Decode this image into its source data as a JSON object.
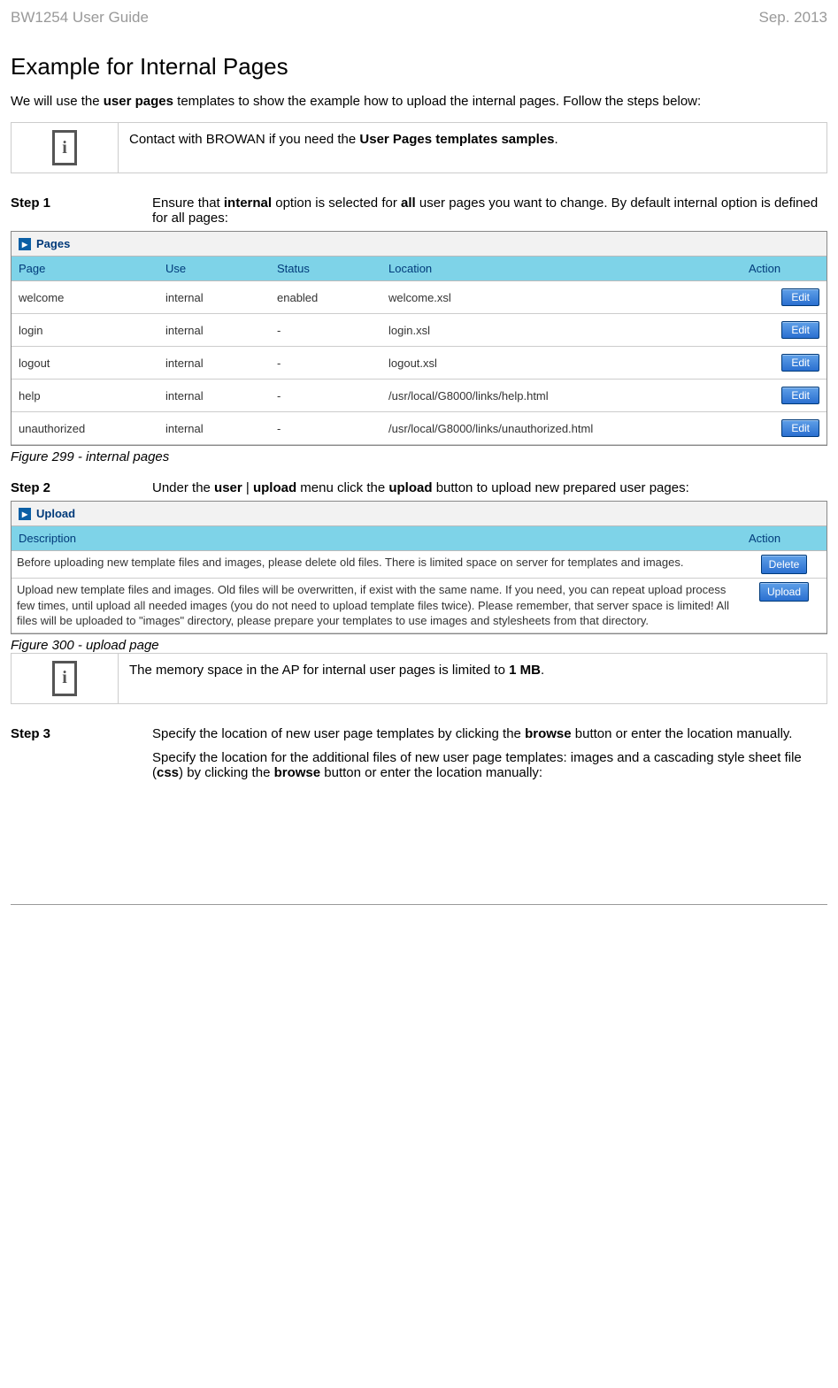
{
  "header": {
    "left": "BW1254 User Guide",
    "right": "Sep. 2013"
  },
  "title": "Example for Internal Pages",
  "intro": {
    "pre": "We will use the ",
    "bold1": "user pages",
    "post": " templates to show the example how to upload the internal pages. Follow the steps below:"
  },
  "note1": {
    "pre": "Contact with BROWAN if you need the ",
    "bold": "User Pages templates samples",
    "post": "."
  },
  "step1": {
    "label": "Step 1",
    "t1": "Ensure that ",
    "b1": "internal",
    "t2": " option is selected for ",
    "b2": "all",
    "t3": " user pages you want to change. By default internal option is defined for all pages:"
  },
  "pages_panel_title": "Pages",
  "pages_cols": {
    "page": "Page",
    "use": "Use",
    "status": "Status",
    "location": "Location",
    "action": "Action"
  },
  "pages_rows": [
    {
      "page": "welcome",
      "use": "internal",
      "status": "enabled",
      "location": "welcome.xsl"
    },
    {
      "page": "login",
      "use": "internal",
      "status": "-",
      "location": "login.xsl"
    },
    {
      "page": "logout",
      "use": "internal",
      "status": "-",
      "location": "logout.xsl"
    },
    {
      "page": "help",
      "use": "internal",
      "status": "-",
      "location": "/usr/local/G8000/links/help.html"
    },
    {
      "page": "unauthorized",
      "use": "internal",
      "status": "-",
      "location": "/usr/local/G8000/links/unauthorized.html"
    }
  ],
  "edit_label": "Edit",
  "fig299": "Figure 299 - internal pages",
  "step2": {
    "label": "Step 2",
    "t1": "Under the ",
    "b1": "user",
    "t2": " | ",
    "b2": "upload",
    "t3": " menu click the ",
    "b3": "upload",
    "t4": " button to upload new prepared user pages:"
  },
  "upload_panel_title": "Upload",
  "upload_cols": {
    "desc": "Description",
    "action": "Action"
  },
  "upload_rows": [
    {
      "desc": "Before uploading new template files and images, please delete old files. There is limited space on server for templates and images.",
      "btn": "Delete"
    },
    {
      "desc": "Upload new template files and images. Old files will be overwritten, if exist with the same name. If you need, you can repeat upload process few times, until upload all needed images (you do not need to upload template files twice). Please remember, that server space is limited! All files will be uploaded to \"images\" directory, please prepare your templates to use images and stylesheets from that directory.",
      "btn": "Upload"
    }
  ],
  "fig300": "Figure 300 - upload page",
  "note2": {
    "pre": "The memory space in the AP for internal user pages is limited to ",
    "bold": "1 MB",
    "post": "."
  },
  "step3": {
    "label": "Step 3",
    "p1_t1": "Specify the location of new user page templates by clicking the ",
    "p1_b1": "browse",
    "p1_t2": " button or enter the location manually.",
    "p2_t1": "Specify the location for the additional files of new user page templates: images and a cascading style sheet file (",
    "p2_b1": "css",
    "p2_t2": ") by clicking the ",
    "p2_b2": "browse",
    "p2_t3": " button or enter the location manually:"
  }
}
